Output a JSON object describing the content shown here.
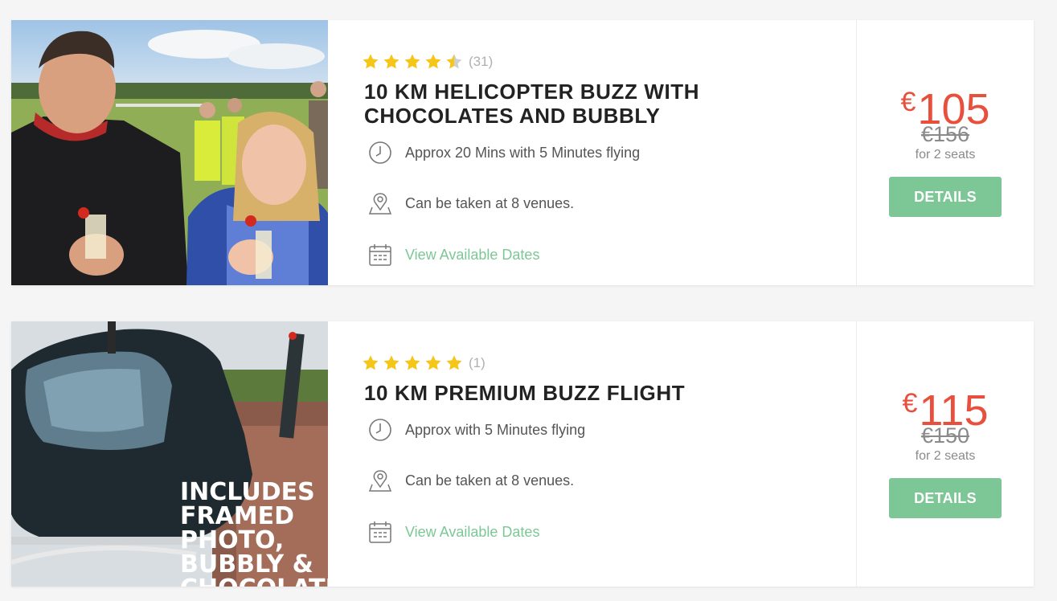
{
  "listings": [
    {
      "rating": 4.5,
      "review_count": "(31)",
      "title": "10 KM HELICOPTER BUZZ WITH CHOCOLATES AND BUBBLY",
      "duration": "Approx 20 Mins with 5 Minutes flying",
      "venues": "Can be taken at 8 venues.",
      "dates_link": "View Available Dates",
      "currency": "€",
      "price": "105",
      "old_price": "€156",
      "seats": "for 2 seats",
      "button": "DETAILS",
      "image": "couple-with-champagne-photo"
    },
    {
      "rating": 5,
      "review_count": "(1)",
      "title": "10 KM PREMIUM BUZZ FLIGHT",
      "duration": "Approx with 5 Minutes flying",
      "venues": "Can be taken at 8 venues.",
      "dates_link": "View Available Dates",
      "currency": "€",
      "price": "115",
      "old_price": "€150",
      "seats": "for 2 seats",
      "button": "DETAILS",
      "image": "helicopter-photo",
      "image_overlay_text": "INCLUDES FRAMED PHOTO, BUBBLY & CHOCOLATE"
    }
  ],
  "colors": {
    "accent_green": "#7cc795",
    "price_red": "#e8503e",
    "star_gold": "#f5c518"
  },
  "icons": {
    "duration": "clock-icon",
    "venues": "map-pin-icon",
    "dates": "calendar-icon",
    "rating": "star-icon"
  }
}
